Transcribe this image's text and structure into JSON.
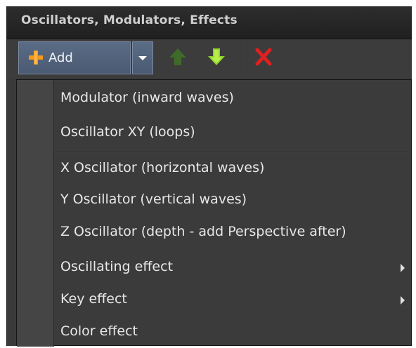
{
  "panel": {
    "title": "Oscillators, Modulators, Effects"
  },
  "toolbar": {
    "add_label": "Add",
    "add_icon": "plus-icon",
    "dropdown_icon": "chevron-down-icon",
    "move_up_icon": "arrow-up-icon",
    "move_down_icon": "arrow-down-icon",
    "delete_icon": "close-icon",
    "colors": {
      "add_icon": "#f39a1e",
      "move_up_disabled": "#3f6b2a",
      "move_down": "#8fd22a",
      "delete": "#e02020"
    }
  },
  "menu": {
    "items": [
      {
        "label": "Modulator (inward waves)",
        "submenu": false
      },
      {
        "label": "Oscillator XY (loops)",
        "submenu": false
      },
      {
        "label": "X Oscillator (horizontal waves)",
        "submenu": false
      },
      {
        "label": "Y Oscillator (vertical waves)",
        "submenu": false
      },
      {
        "label": "Z Oscillator (depth - add Perspective after)",
        "submenu": false
      },
      {
        "label": "Oscillating effect",
        "submenu": true
      },
      {
        "label": "Key effect",
        "submenu": true
      },
      {
        "label": "Color effect",
        "submenu": false
      }
    ]
  }
}
